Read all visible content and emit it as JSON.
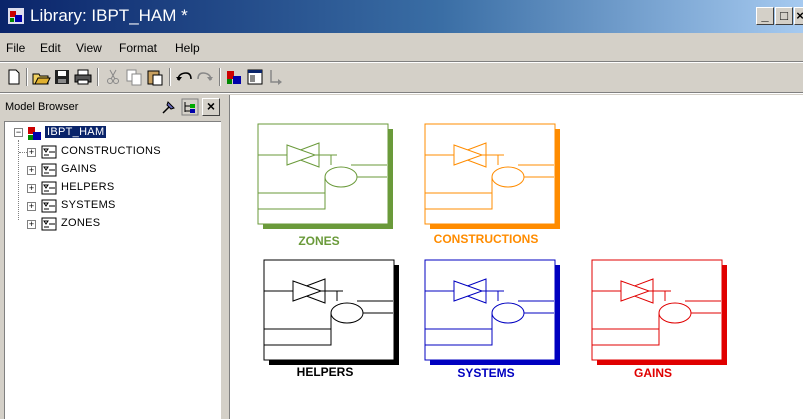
{
  "window": {
    "title": "Library: IBPT_HAM *",
    "minimize_label": "_",
    "maximize_label": "□",
    "close_label": "×"
  },
  "menu": {
    "items": [
      {
        "label": "File"
      },
      {
        "label": "Edit"
      },
      {
        "label": "View"
      },
      {
        "label": "Format"
      },
      {
        "label": "Help"
      }
    ]
  },
  "toolbar": {
    "buttons": [
      "new-icon",
      "open-icon",
      "save-icon",
      "print-icon",
      "cut-icon",
      "copy-icon",
      "paste-icon",
      "undo-icon",
      "redo-icon",
      "library-icon",
      "browser-icon",
      "arrow-icon"
    ]
  },
  "browser": {
    "title": "Model Browser",
    "close_label": "×",
    "root": {
      "label": "IBPT_HAM",
      "expander": "−"
    },
    "children": [
      {
        "label": "CONSTRUCTIONS",
        "expander": "+"
      },
      {
        "label": "GAINS",
        "expander": "+"
      },
      {
        "label": "HELPERS",
        "expander": "+"
      },
      {
        "label": "SYSTEMS",
        "expander": "+"
      },
      {
        "label": "ZONES",
        "expander": "+"
      }
    ]
  },
  "canvas": {
    "blocks": [
      {
        "label": "ZONES",
        "color": "#6a9a3a"
      },
      {
        "label": "CONSTRUCTIONS",
        "color": "#ff8c00"
      },
      {
        "label": "HELPERS",
        "color": "#000000"
      },
      {
        "label": "SYSTEMS",
        "color": "#0000c0"
      },
      {
        "label": "GAINS",
        "color": "#e00000"
      }
    ]
  }
}
